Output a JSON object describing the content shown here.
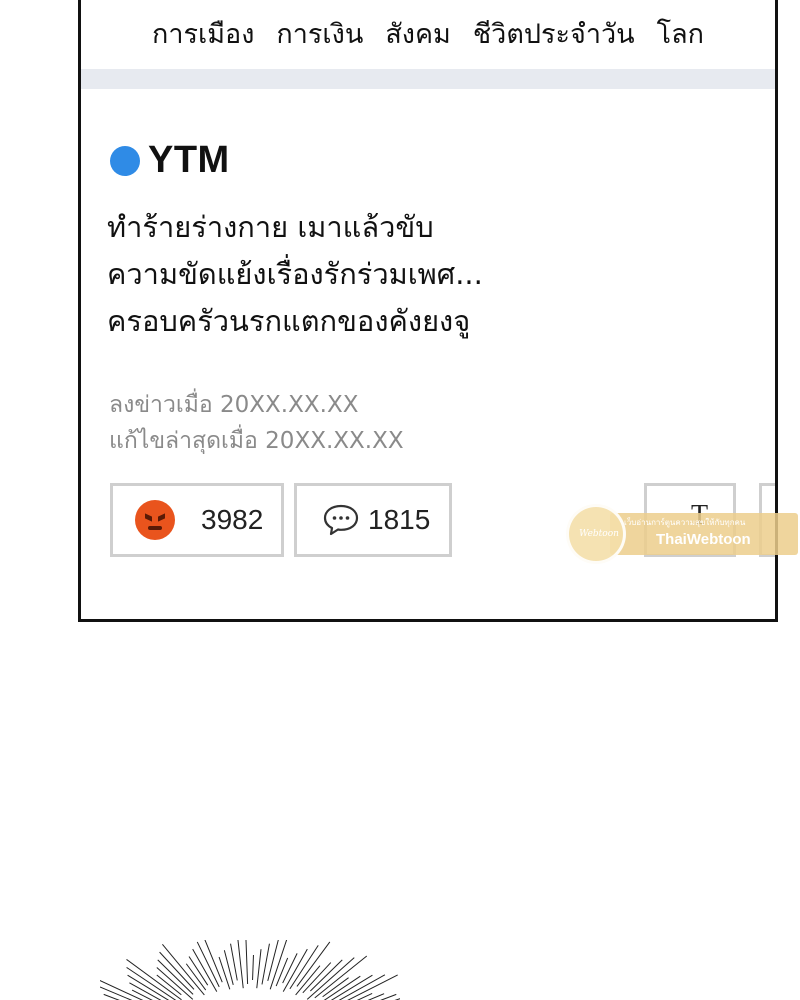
{
  "nav": {
    "items": [
      "การเมือง",
      "การเงิน",
      "สังคม",
      "ชีวิตประจำวัน",
      "โลก"
    ]
  },
  "article": {
    "source": "YTM",
    "headline_lines": [
      "ทำร้ายร่างกาย เมาแล้วขับ",
      "ความขัดแย้งเรื่องรักร่วมเพศ...",
      "ครอบครัวนรกแตกของคังยงจู"
    ],
    "posted": "ลงข่าวเมื่อ 20XX.XX.XX",
    "edited": "แก้ไขล่าสุดเมื่อ 20XX.XX.XX"
  },
  "reactions": {
    "angry_icon": "angry-face-icon",
    "angry_count": "3982",
    "comment_icon": "speech-bubble-icon",
    "comment_count": "1815",
    "font_size_label": "T"
  },
  "watermark": {
    "logo_text": "Webtoon",
    "tagline": "เว็บอ่านการ์ตูนความสุขให้กับทุกคน",
    "brand": "ThaiWebtoon"
  },
  "colors": {
    "source_dot": "#2f8be6",
    "angry": "#e9541d",
    "separator": "#e7eaf0",
    "meta_text": "#8a8a8a"
  }
}
